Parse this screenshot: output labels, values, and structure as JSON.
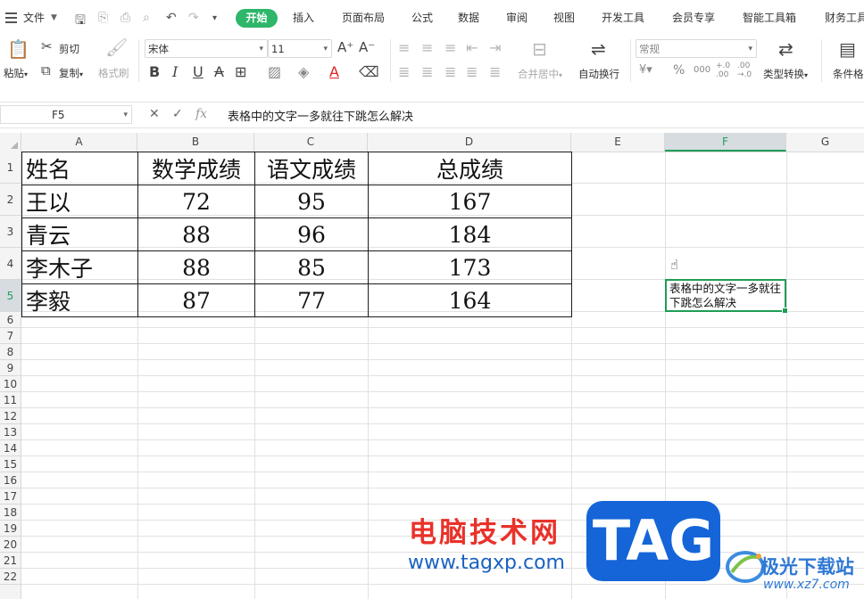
{
  "menubar": {
    "file": "文件",
    "tabs": [
      "开始",
      "插入",
      "页面布局",
      "公式",
      "数据",
      "审阅",
      "视图",
      "开发工具",
      "会员专享",
      "智能工具箱",
      "财务工具"
    ],
    "active_tab": "开始",
    "accent_color": "#2eb669"
  },
  "ribbon": {
    "cut": "剪切",
    "paste": "粘贴",
    "copy": "复制",
    "format_painter": "格式刷",
    "font_name": "宋体",
    "font_size": "11",
    "merge_center": "合并居中",
    "auto_wrap": "自动换行",
    "number_format": "常规",
    "percent": "%",
    "thousand": "000",
    "dec_inc": "+.0 .00",
    "dec_dec": ".00 →.0",
    "type_convert": "类型转换",
    "cond_format": "条件格式",
    "bold": "B",
    "italic": "I",
    "underline": "U",
    "strike": "A",
    "font_color": "A",
    "grow": "A⁺",
    "shrink": "A⁻"
  },
  "formula_bar": {
    "cell_ref": "F5",
    "fx": "fx",
    "content": "表格中的文字一多就往下跳怎么解决"
  },
  "columns": [
    "A",
    "B",
    "C",
    "D",
    "E",
    "F",
    "G"
  ],
  "rows": [
    "1",
    "2",
    "3",
    "4",
    "5",
    "6",
    "7",
    "8",
    "9",
    "10",
    "11",
    "12",
    "13",
    "14",
    "15",
    "16",
    "17",
    "18",
    "19",
    "20",
    "21",
    "22"
  ],
  "selected_column": "F",
  "selected_row": "5",
  "table": {
    "headers": [
      "姓名",
      "数学成绩",
      "语文成绩",
      "总成绩"
    ],
    "rows": [
      [
        "王以",
        "72",
        "95",
        "167"
      ],
      [
        "青云",
        "88",
        "96",
        "184"
      ],
      [
        "李木子",
        "88",
        "85",
        "173"
      ],
      [
        "李毅",
        "87",
        "77",
        "164"
      ]
    ]
  },
  "cell_f5": "表格中的文字一多就往下跳怎么解决",
  "watermark": {
    "brand": "电脑技术网",
    "url": "www.tagxp.com",
    "tag": "TAG",
    "site": "极光下载站",
    "site_url": "www.xz7.com"
  }
}
